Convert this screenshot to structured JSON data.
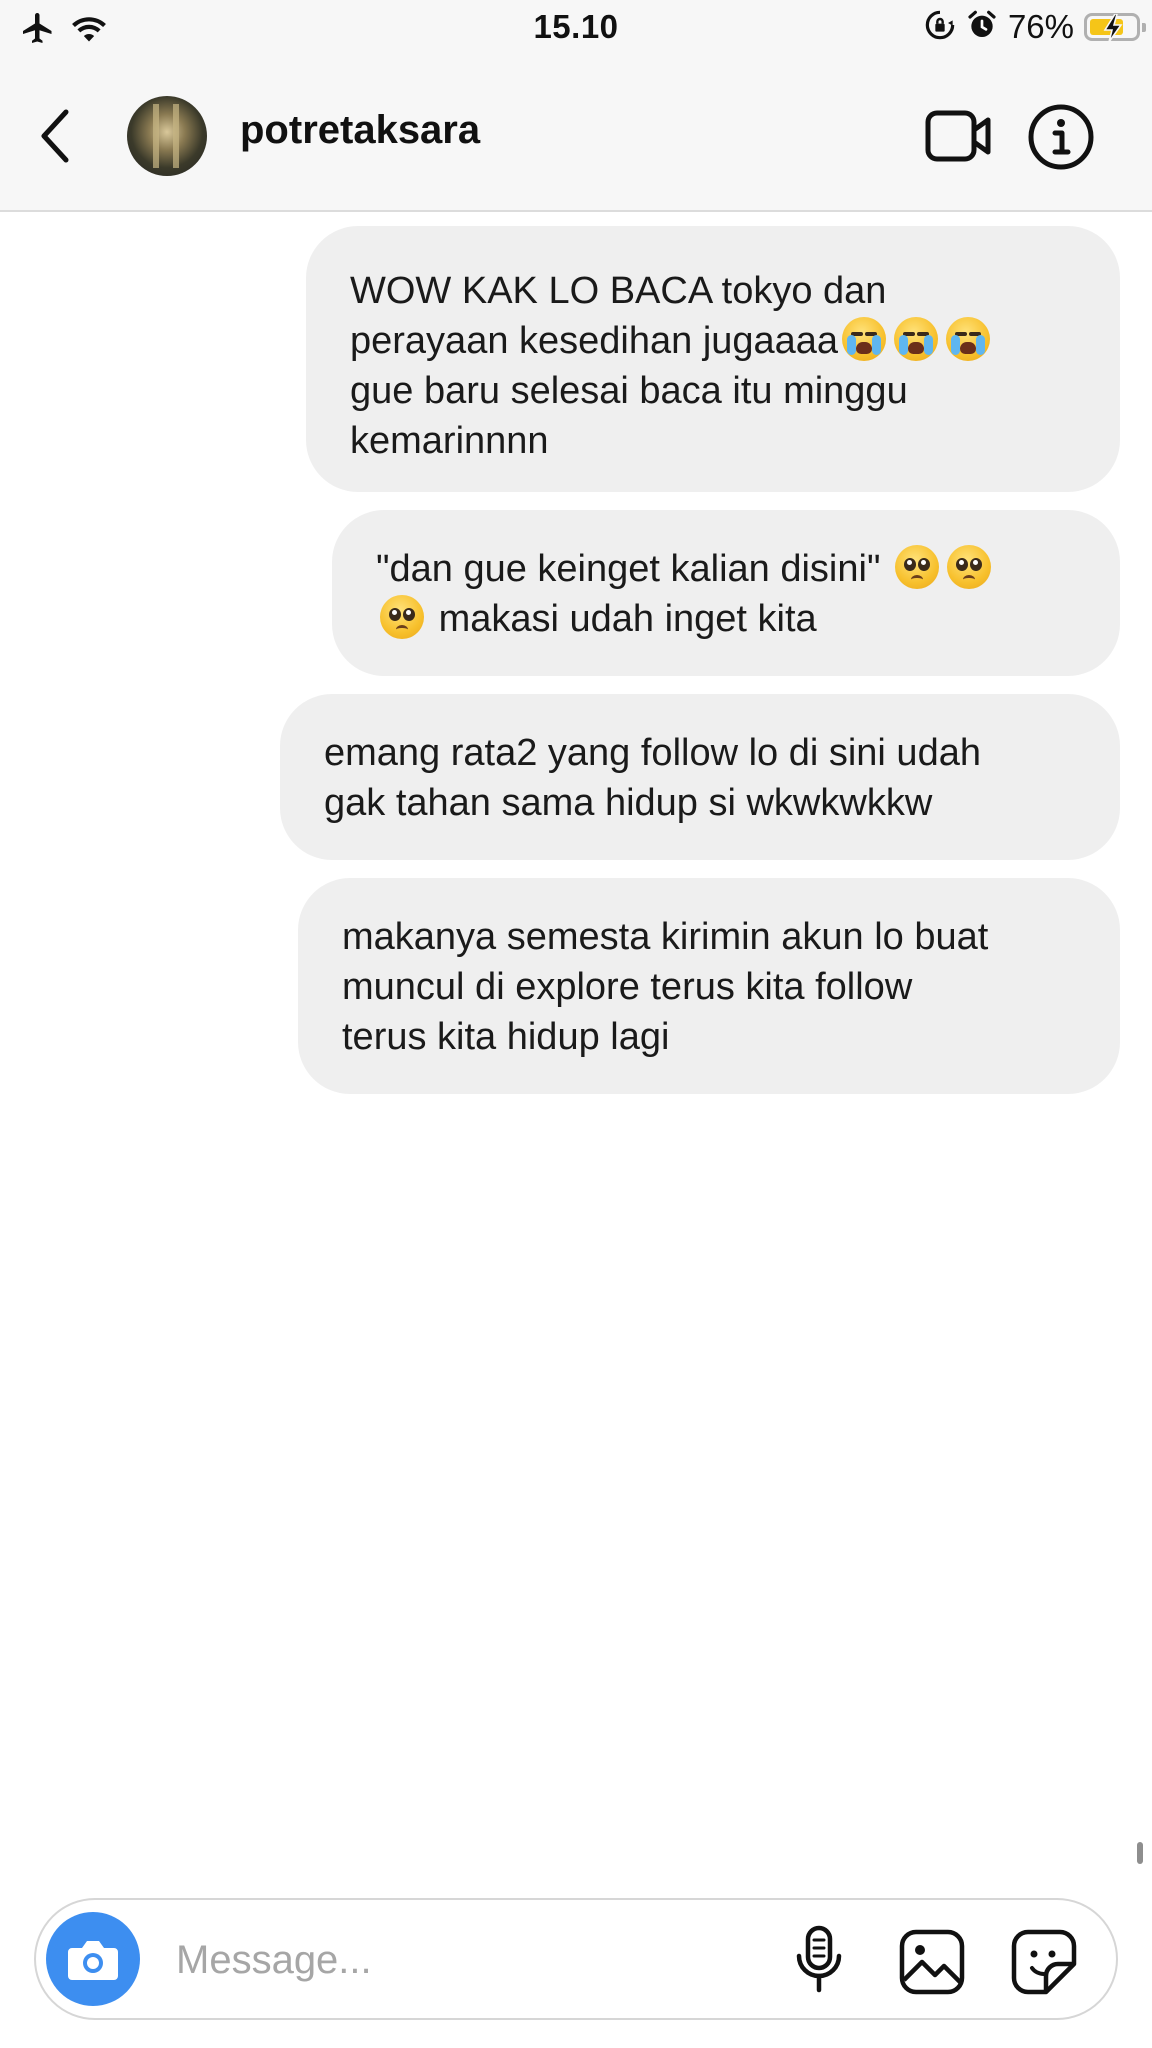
{
  "status_bar": {
    "time": "15.10",
    "battery_percent": "76%",
    "battery_level": 0.76,
    "icons": [
      "airplane-mode-icon",
      "wifi-icon",
      "orientation-lock-icon",
      "alarm-icon",
      "battery-charging-icon"
    ]
  },
  "header": {
    "username": "potretaksara",
    "icons": [
      "back-chevron-icon",
      "avatar",
      "video-call-icon",
      "info-icon"
    ]
  },
  "messages": [
    {
      "sender": "me",
      "lines": [
        {
          "text": "WOW KAK LO BACA tokyo dan"
        },
        {
          "text": "perayaan kesedihan jugaaaa",
          "emoji": [
            "loudly-crying-face",
            "loudly-crying-face",
            "loudly-crying-face"
          ]
        },
        {
          "text": "gue baru selesai baca itu minggu"
        },
        {
          "text": "kemarinnnn"
        }
      ]
    },
    {
      "sender": "me",
      "lines": [
        {
          "text": "\"dan gue keinget kalian disini\"",
          "emoji": [
            "pleading-face",
            "pleading-face"
          ]
        },
        {
          "text": "makasi udah inget kita",
          "emoji_before": [
            "pleading-face"
          ]
        }
      ]
    },
    {
      "sender": "me",
      "lines": [
        {
          "text": "emang rata2 yang follow lo di sini udah"
        },
        {
          "text": "gak tahan sama hidup si wkwkwkkw"
        }
      ]
    },
    {
      "sender": "me",
      "lines": [
        {
          "text": "makanya semesta kirimin akun lo buat"
        },
        {
          "text": "muncul di explore terus kita follow"
        },
        {
          "text": "terus kita hidup lagi"
        }
      ]
    }
  ],
  "composer": {
    "placeholder": "Message...",
    "value": "",
    "icons": [
      "camera-icon",
      "microphone-icon",
      "gallery-icon",
      "sticker-icon"
    ]
  },
  "colors": {
    "bubble": "#efefef",
    "camera_button": "#3d8ef0",
    "battery_fill": "#f5c518",
    "placeholder": "#a6a6a6"
  }
}
